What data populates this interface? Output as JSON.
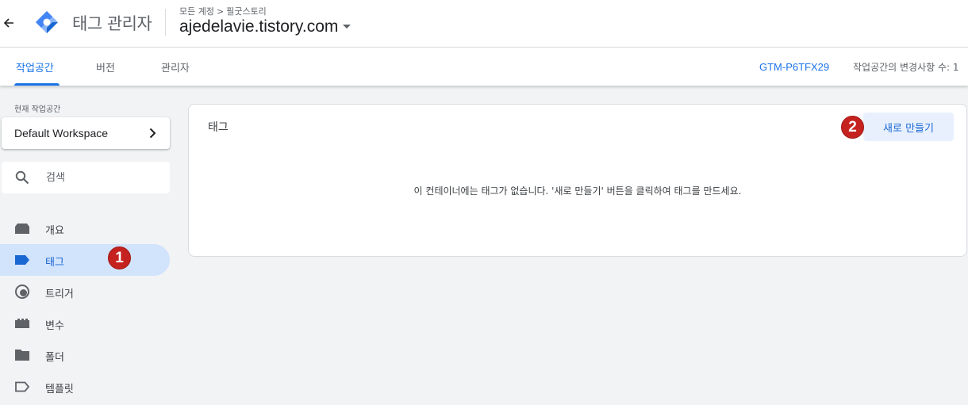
{
  "header": {
    "back_icon": "arrow-back-icon",
    "logo_icon": "tag-manager-logo",
    "app_title": "태그 관리자",
    "breadcrumb": {
      "account": "모든 계정",
      "separator": ">",
      "property": "필굿스토리"
    },
    "container_name": "ajedelavie.tistory.com",
    "dropdown_icon": "caret-down-icon"
  },
  "tabs": [
    {
      "label": "작업공간",
      "active": true
    },
    {
      "label": "버전",
      "active": false
    },
    {
      "label": "관리자",
      "active": false
    }
  ],
  "container_id": "GTM-P6TFX29",
  "workspace_changes": "작업공간의 변경사항 수: 1",
  "sidebar": {
    "workspace_label": "현재 작업공간",
    "workspace_name": "Default Workspace",
    "search_placeholder": "검색",
    "items": [
      {
        "label": "개요",
        "icon": "overview-icon",
        "active": false
      },
      {
        "label": "태그",
        "icon": "tag-icon",
        "active": true
      },
      {
        "label": "트리거",
        "icon": "trigger-icon",
        "active": false
      },
      {
        "label": "변수",
        "icon": "variable-icon",
        "active": false
      },
      {
        "label": "폴더",
        "icon": "folder-icon",
        "active": false
      },
      {
        "label": "템플릿",
        "icon": "template-icon",
        "active": false
      }
    ]
  },
  "main": {
    "title": "태그",
    "new_button": "새로 만들기",
    "empty_message": "이 컨테이너에는 태그가 없습니다. '새로 만들기' 버튼을 클릭하여 태그를 만드세요."
  },
  "annotations": {
    "marker1": "1",
    "marker2": "2"
  },
  "colors": {
    "accent": "#1a73e8",
    "active_bg": "#d2e3fc",
    "button_bg": "#e8f0fe",
    "marker": "#c5221f"
  }
}
